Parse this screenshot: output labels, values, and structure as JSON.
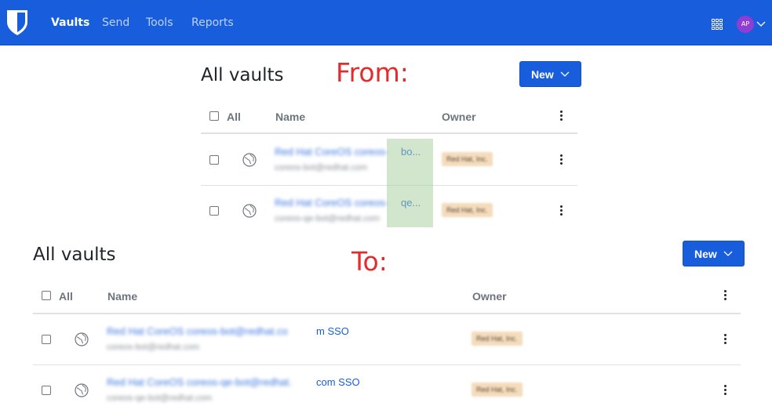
{
  "nav": {
    "items": [
      {
        "label": "Vaults",
        "active": true
      },
      {
        "label": "Send",
        "active": false
      },
      {
        "label": "Tools",
        "active": false
      },
      {
        "label": "Reports",
        "active": false
      }
    ],
    "avatar_initials": "AP",
    "brand_color": "#175ddc",
    "avatar_color": "#8f3ed3"
  },
  "annotations": {
    "from": "From:",
    "to": "To:"
  },
  "before": {
    "title": "All vaults",
    "new_button": "New",
    "columns": {
      "all": "All",
      "name": "Name",
      "owner": "Owner"
    },
    "rows": [
      {
        "name_blurred": "Red Hat CoreOS coreos-",
        "name_visible": "bo...",
        "subtitle": "coreos-bot@redhat.com",
        "owner": "Red Hat, Inc."
      },
      {
        "name_blurred": "Red Hat CoreOS coreos-",
        "name_visible": "qe...",
        "subtitle": "coreos-qe-bot@redhat.com",
        "owner": "Red Hat, Inc."
      }
    ]
  },
  "after": {
    "title": "All vaults",
    "new_button": "New",
    "columns": {
      "all": "All",
      "name": "Name",
      "owner": "Owner"
    },
    "rows": [
      {
        "name_blurred": "Red Hat CoreOS coreos-bot@redhat.co",
        "name_visible": "m SSO",
        "subtitle": "coreos-bot@redhat.com",
        "owner": "Red Hat, Inc."
      },
      {
        "name_blurred": "Red Hat CoreOS coreos-qe-bot@redhat.",
        "name_visible": "com SSO",
        "subtitle": "coreos-qe-bot@redhat.com",
        "owner": "Red Hat, Inc."
      }
    ]
  }
}
